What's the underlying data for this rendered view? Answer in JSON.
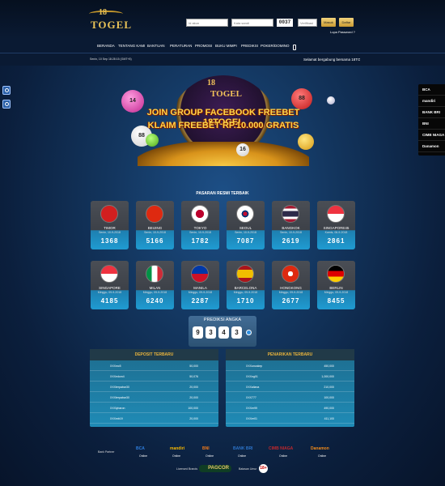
{
  "header": {
    "logo_top": "18",
    "logo_bottom": "TOGEL",
    "login": {
      "username_placeholder": "Id akun",
      "password_placeholder": "Kata sandi",
      "captcha_value": "0037",
      "captcha_placeholder": "Verifikasi",
      "login_label": "Masuk",
      "register_label": "Daftar",
      "forgot_label": "Lupa Password ?"
    }
  },
  "nav": {
    "items": [
      "BERANDA",
      "TENTANG KAMI",
      "BANTUAN",
      "PERATURAN",
      "PROMOSI",
      "BUKU MIMPI",
      "PREDIKSI",
      "POKER/DOMINO"
    ],
    "mobile_icon": "mobile-phone-icon"
  },
  "infobar": {
    "datetime": "Senin, 10 Sep 18:28:15 (GMT+8)",
    "marquee": "Selamat bergabung bersama 18TOGEL"
  },
  "side_buttons": [
    "chat-icon",
    "whatsapp-icon"
  ],
  "banks_sidebar": [
    "BCA",
    "mandiri",
    "BANK BRI",
    "BNI",
    "CIMB NIAGA",
    "Danamon"
  ],
  "banner": {
    "logo_top": "18",
    "logo_bottom": "TOGEL",
    "line1": "JOIN GROUP FACEBOOK FREEBET 18TOGEL",
    "line2": "KLAIM FREEBET RP.10.000 GRATIS",
    "balls": [
      "14",
      "88",
      "88",
      "16",
      "2"
    ]
  },
  "pasaran": {
    "title": "PASARAN RESMI TERBAIK",
    "markets": [
      {
        "name": "TIMOR",
        "date": "Senin, 10-9-2018",
        "result": "1368",
        "flag": "timor"
      },
      {
        "name": "BEIJING",
        "date": "Senin, 10-9-2018",
        "result": "5166",
        "flag": "china"
      },
      {
        "name": "TOKYO",
        "date": "Senin, 10-9-2018",
        "result": "1782",
        "flag": "japan"
      },
      {
        "name": "SEOUL",
        "date": "Senin, 10-9-2018",
        "result": "7087",
        "flag": "korea"
      },
      {
        "name": "BANGKOK",
        "date": "Senin, 10-9-2018",
        "result": "2619",
        "flag": "thailand"
      },
      {
        "name": "SINGAPORE45",
        "date": "Kamis, 06-9-2018",
        "result": "2861",
        "flag": "singapore"
      },
      {
        "name": "SINGAPORE",
        "date": "Minggu, 09-9-2018",
        "result": "4185",
        "flag": "singapore"
      },
      {
        "name": "MILAN",
        "date": "Minggu, 09-9-2018",
        "result": "6240",
        "flag": "italy"
      },
      {
        "name": "MANILA",
        "date": "Minggu, 09-9-2018",
        "result": "2287",
        "flag": "philippines"
      },
      {
        "name": "BARCELONA",
        "date": "Minggu, 09-9-2018",
        "result": "1710",
        "flag": "spain"
      },
      {
        "name": "HONGKONG",
        "date": "Minggu, 09-9-2018",
        "result": "2677",
        "flag": "hongkong"
      },
      {
        "name": "BERLIN",
        "date": "Minggu, 09-9-2018",
        "result": "8455",
        "flag": "germany"
      }
    ]
  },
  "prediksi": {
    "title": "PREDIKSI ANGKA",
    "digits": [
      "9",
      "3",
      "4",
      "3"
    ]
  },
  "deposit": {
    "title": "DEPOSIT TERBARU",
    "rows": [
      {
        "user": "XXXmc5",
        "amount": "50,000"
      },
      {
        "user": "XXXedom4",
        "amount": "50,076"
      },
      {
        "user": "XXXterpabar30",
        "amount": "20,000"
      },
      {
        "user": "XXXterpabar30",
        "amount": "20,000"
      },
      {
        "user": "XXXlybaron",
        "amount": "100,000"
      },
      {
        "user": "XXXmb19",
        "amount": "20,000"
      }
    ]
  },
  "penarikan": {
    "title": "PENARIKAN TERBARU",
    "rows": [
      {
        "user": "XXXuncakep",
        "amount": "450,000"
      },
      {
        "user": "XXXng01",
        "amount": "1,000,000"
      },
      {
        "user": "XXXaliana",
        "amount": "210,000"
      },
      {
        "user": "XXX777",
        "amount": "100,000"
      },
      {
        "user": "XXXer99",
        "amount": "490,000"
      },
      {
        "user": "XXXer01",
        "amount": "411,100"
      }
    ]
  },
  "footer": {
    "partner_label": "Bank Partner",
    "partners": [
      "BCA",
      "mandiri",
      "BNI",
      "BANK BRI",
      "CIMB NIAGA",
      "Danamon"
    ],
    "online_label": "Online",
    "license_label": "Licensed Brands",
    "license_brand": "PAGCOR",
    "age_label": "Batasan Umur",
    "age_value": "18+"
  }
}
